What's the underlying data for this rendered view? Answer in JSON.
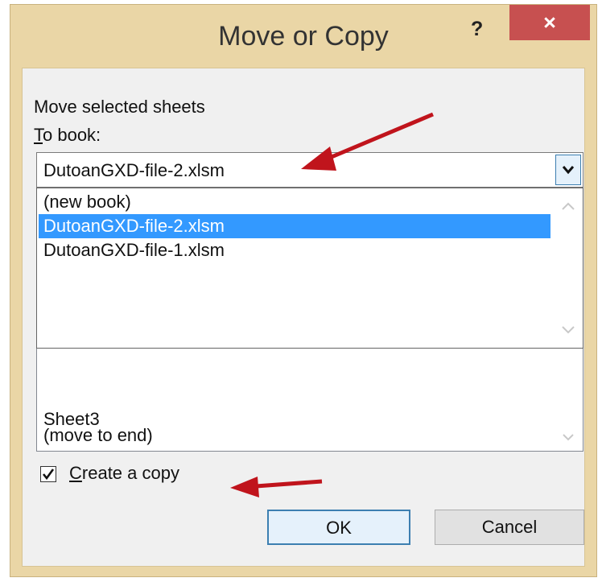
{
  "dialog": {
    "title": "Move or Copy",
    "help_label": "?",
    "close_label": "×",
    "move_label": "Move selected sheets",
    "to_book_label_underlined": "T",
    "to_book_label_rest": "o book:",
    "combo_value": "DutoanGXD-file-2.xlsm",
    "dropdown_items": [
      "(new book)",
      "DutoanGXD-file-2.xlsm",
      "DutoanGXD-file-1.xlsm"
    ],
    "before_sheet_items": [
      "Sheet3",
      "(move to end)"
    ],
    "checkbox_checked": true,
    "checkbox_label_underlined": "C",
    "checkbox_label_rest": "reate a copy",
    "ok_label": "OK",
    "cancel_label": "Cancel"
  },
  "colors": {
    "frame": "#ead6a6",
    "close_button": "#c75050",
    "selected_item": "#3399ff",
    "annotation_arrow": "#c0141c"
  }
}
